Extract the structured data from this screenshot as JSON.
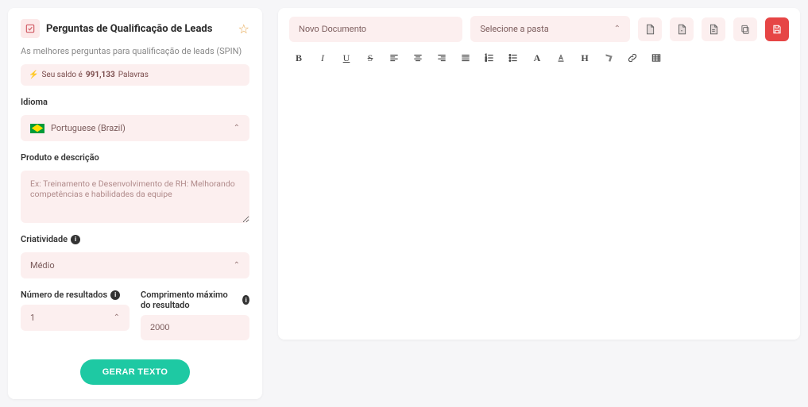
{
  "header": {
    "title": "Perguntas de Qualificação de Leads",
    "subtitle": "As melhores perguntas para qualificação de leads (SPIN)"
  },
  "balance": {
    "prefix": "Seu saldo é",
    "number": "991,133",
    "suffix": "Palavras"
  },
  "labels": {
    "language": "Idioma",
    "product": "Produto e descrição",
    "creativity": "Criatividade",
    "num_results": "Número de resultados",
    "max_length": "Comprimento máximo do resultado"
  },
  "language": {
    "selected": "Portuguese (Brazil)"
  },
  "product_placeholder": "Ex: Treinamento e Desenvolvimento de RH: Melhorando competências e habilidades da equipe",
  "creativity": {
    "selected": "Médio"
  },
  "num_results": "1",
  "max_length": "2000",
  "generate_label": "GERAR TEXTO",
  "document_name": "Novo Documento",
  "folder_placeholder": "Selecione a pasta",
  "toolbar_icons": [
    "bold",
    "italic",
    "underline",
    "strike",
    "align-left",
    "align-center",
    "align-right",
    "align-justify",
    "ol",
    "ul",
    "font-size",
    "color",
    "header",
    "clear-format",
    "link",
    "table"
  ],
  "action_icons": [
    "doc-download",
    "doc-export",
    "doc-copy",
    "duplicate",
    "save"
  ]
}
